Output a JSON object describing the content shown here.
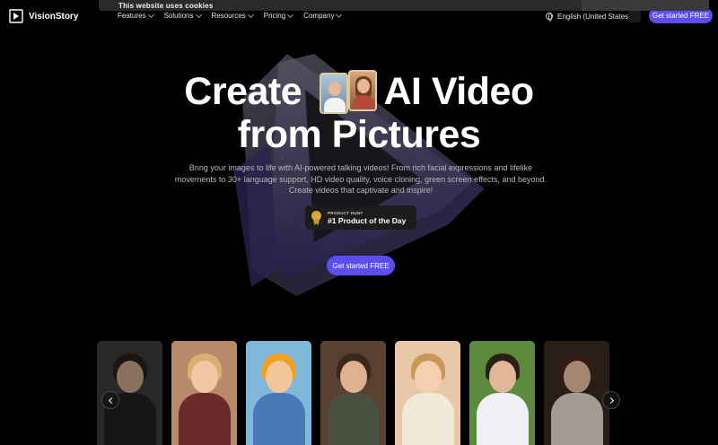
{
  "cookie": {
    "text": "This website uses cookies"
  },
  "brand": {
    "name": "VisionStory"
  },
  "nav": {
    "items": [
      {
        "label": "Features"
      },
      {
        "label": "Solutions"
      },
      {
        "label": "Resources"
      },
      {
        "label": "Pricing"
      },
      {
        "label": "Company"
      }
    ],
    "language": "English (United States)",
    "cta": "Get started FREE"
  },
  "hero": {
    "title_line1_a": "Create",
    "title_line1_b": "AI Video",
    "title_line2": "from Pictures",
    "subtitle": "Bring your images to life with AI-powered talking videos! From rich facial expressions and lifelike movements to 30+ language support, HD video quality, voice cloning, green screen effects, and beyond. Create videos that captivate and inspire!",
    "badge_small": "PRODUCT HUNT",
    "badge_big": "#1 Product of the Day",
    "cta": "Get started FREE"
  },
  "colors": {
    "accent": "#5b4df0",
    "background": "#000000"
  },
  "carousel": {
    "cards": [
      {
        "name": "man-glasses-dark",
        "bg": "#3a3a3a",
        "skin": "#c8a088",
        "cloth": "#1f1f1f",
        "hair": "#2a2018"
      },
      {
        "name": "blonde-woman",
        "bg": "#b98a6a",
        "skin": "#f0c8a8",
        "cloth": "#6b2a2a",
        "hair": "#d9b070"
      },
      {
        "name": "cartoon-girl-helmet",
        "bg": "#7fb8d8",
        "skin": "#f4c49a",
        "cloth": "#4a78b8",
        "hair": "#f0a020"
      },
      {
        "name": "man-curly-glasses",
        "bg": "#5a4030",
        "skin": "#e0b090",
        "cloth": "#4a5040",
        "hair": "#3a2818"
      },
      {
        "name": "woman-white-dress",
        "bg": "#e8c8a8",
        "skin": "#f4d0b0",
        "cloth": "#f2ead8",
        "hair": "#c89858"
      },
      {
        "name": "man-suit",
        "bg": "#5a8a3a",
        "skin": "#e0b898",
        "cloth": "#eef0f6",
        "hair": "#2a2018"
      },
      {
        "name": "woman-vintage",
        "bg": "#3a2a22",
        "skin": "#e8c0a0",
        "cloth": "#e8ddd0",
        "hair": "#4a2a18"
      }
    ]
  }
}
